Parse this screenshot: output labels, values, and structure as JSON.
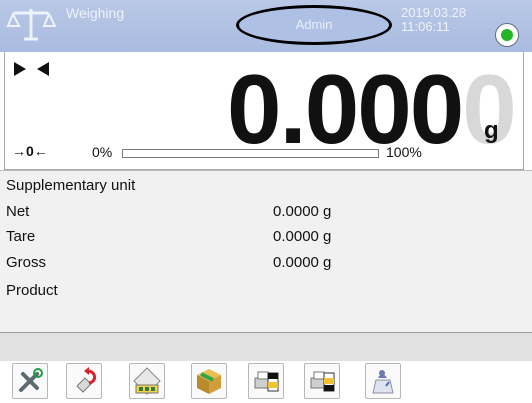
{
  "header": {
    "mode_title": "Weighing",
    "user_label": "Admin",
    "datetime": "2019.03.28\n11:06:11",
    "status_color": "#22b527",
    "scale_icon": "balance-icon"
  },
  "reading": {
    "value": "0.000",
    "ghost_digit": "0",
    "unit": "g",
    "zero_marker": "→0←",
    "range_min": "0%",
    "range_max": "100%",
    "fill_fraction": 0.0
  },
  "info_rows": [
    {
      "label": "Supplementary unit",
      "value": ""
    },
    {
      "label": "Net",
      "value": "0.0000 g"
    },
    {
      "label": "Tare",
      "value": "0.0000 g"
    },
    {
      "label": "Gross",
      "value": "0.0000 g"
    },
    {
      "label": "Product",
      "value": ""
    }
  ],
  "toolbar": {
    "buttons": [
      "tools-icon",
      "undo-tare-icon",
      "tare-database-icon",
      "product-box-icon",
      "printer-header-icon",
      "printer-footer-icon",
      "weight-user-icon"
    ]
  }
}
